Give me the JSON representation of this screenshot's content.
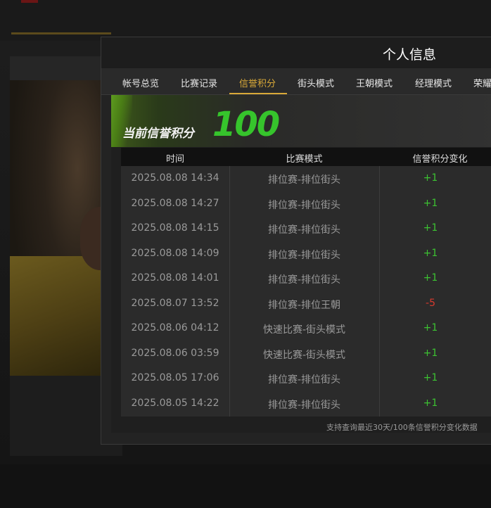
{
  "modal": {
    "title": "个人信息",
    "tabs": [
      {
        "label": "帐号总览"
      },
      {
        "label": "比赛记录"
      },
      {
        "label": "信誉积分"
      },
      {
        "label": "街头模式"
      },
      {
        "label": "王朝模式"
      },
      {
        "label": "经理模式"
      },
      {
        "label": "荣耀"
      }
    ],
    "active_tab": "信誉积分",
    "accent_color": "#d9a938"
  },
  "credit": {
    "label": "当前信誉积分",
    "score": "100",
    "score_color": "#36c42c"
  },
  "table": {
    "headers": [
      "时间",
      "比赛模式",
      "信誉积分变化"
    ],
    "rows": [
      {
        "time": "2025.08.08  14:34",
        "mode": "排位赛-排位街头",
        "change": "+1"
      },
      {
        "time": "2025.08.08  14:27",
        "mode": "排位赛-排位街头",
        "change": "+1"
      },
      {
        "time": "2025.08.08  14:15",
        "mode": "排位赛-排位街头",
        "change": "+1"
      },
      {
        "time": "2025.08.08  14:09",
        "mode": "排位赛-排位街头",
        "change": "+1"
      },
      {
        "time": "2025.08.08  14:01",
        "mode": "排位赛-排位街头",
        "change": "+1"
      },
      {
        "time": "2025.08.07  13:52",
        "mode": "排位赛-排位王朝",
        "change": "-5"
      },
      {
        "time": "2025.08.06  04:12",
        "mode": "快速比赛-街头模式",
        "change": "+1"
      },
      {
        "time": "2025.08.06  03:59",
        "mode": "快速比赛-街头模式",
        "change": "+1"
      },
      {
        "time": "2025.08.05  17:06",
        "mode": "排位赛-排位街头",
        "change": "+1"
      },
      {
        "time": "2025.08.05  14:22",
        "mode": "排位赛-排位街头",
        "change": "+1"
      }
    ],
    "positive_color": "#3cc232",
    "negative_color": "#d83a2e"
  },
  "footer_note": "支持查询最近30天/100条信誉积分变化数据"
}
